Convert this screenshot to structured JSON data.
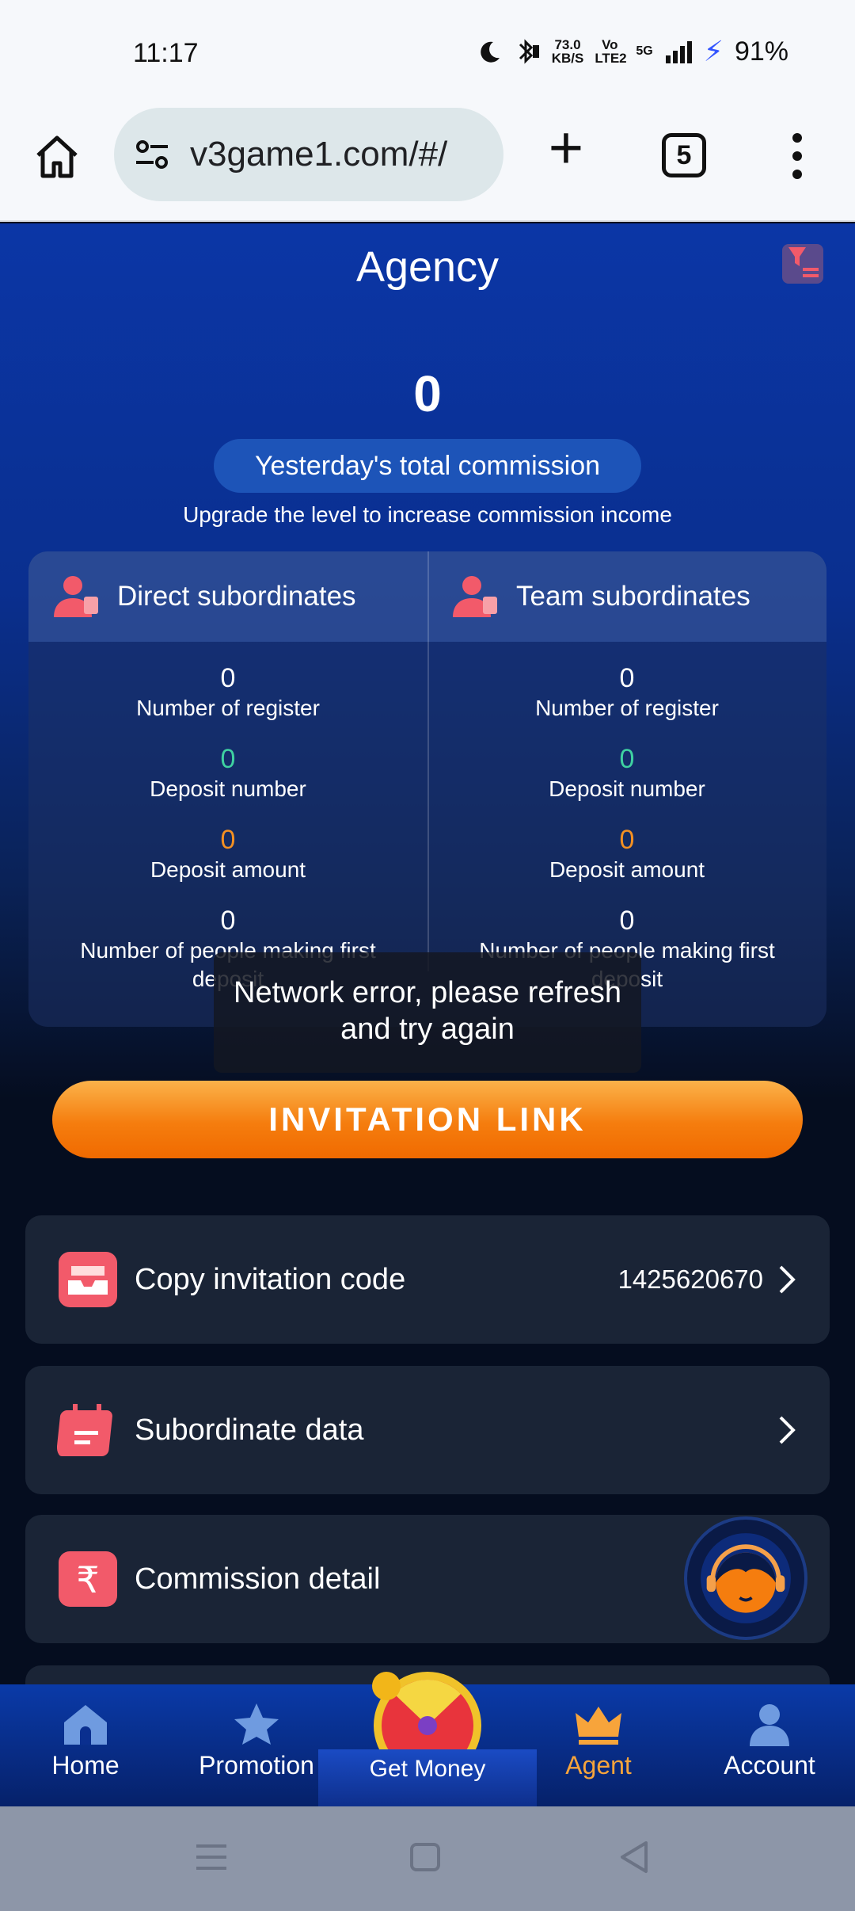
{
  "status_bar": {
    "time": "11:17",
    "net_speed": "73.0",
    "net_unit": "KB/S",
    "volte": "Vo LTE2",
    "signal": "5G",
    "battery": "91%"
  },
  "browser": {
    "url": "v3game1.com/#/",
    "tab_count": "5"
  },
  "page": {
    "title": "Agency",
    "commission_value": "0",
    "commission_label": "Yesterday's total commission",
    "upgrade_text": "Upgrade the level to increase commission income"
  },
  "direct": {
    "title": "Direct subordinates",
    "register_value": "0",
    "register_label": "Number of register",
    "deposit_number_value": "0",
    "deposit_number_label": "Deposit number",
    "deposit_amount_value": "0",
    "deposit_amount_label": "Deposit amount",
    "first_deposit_value": "0",
    "first_deposit_label": "Number of people making first deposit"
  },
  "team": {
    "title": "Team subordinates",
    "register_value": "0",
    "register_label": "Number of register",
    "deposit_number_value": "0",
    "deposit_number_label": "Deposit number",
    "deposit_amount_value": "0",
    "deposit_amount_label": "Deposit amount",
    "first_deposit_value": "0",
    "first_deposit_label": "Number of people making first deposit"
  },
  "toast": "Network error, please refresh and try again",
  "invitation_button": "INVITATION LINK",
  "rows": {
    "copy_code_label": "Copy invitation code",
    "copy_code_value": "1425620670",
    "subordinate_label": "Subordinate data",
    "commission_label": "Commission detail"
  },
  "nav": {
    "home": "Home",
    "promotion": "Promotion",
    "get_money": "Get Money",
    "agent": "Agent",
    "account": "Account"
  },
  "colors": {
    "accent_orange": "#f57d0e",
    "green_value": "#3fd1a1",
    "orange_value": "#f39022",
    "active_nav": "#f7a43b"
  }
}
